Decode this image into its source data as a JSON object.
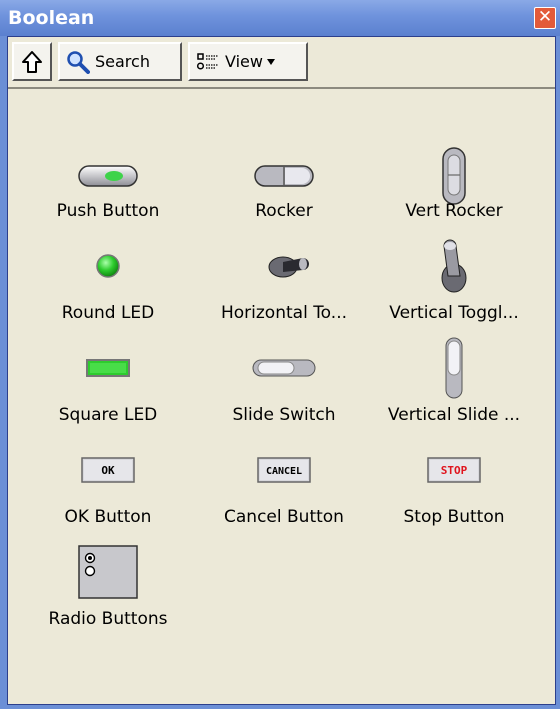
{
  "window": {
    "title": "Boolean",
    "close_glyph": "✕"
  },
  "toolbar": {
    "up_icon": "up-arrow-icon",
    "search_label": "Search",
    "view_label": "View"
  },
  "palette": [
    {
      "label": "Push Button",
      "icon": "push-button-icon"
    },
    {
      "label": "Rocker",
      "icon": "rocker-icon"
    },
    {
      "label": "Vert Rocker",
      "icon": "vert-rocker-icon"
    },
    {
      "label": "Round LED",
      "icon": "round-led-icon"
    },
    {
      "label": "Horizontal To...",
      "icon": "horizontal-toggle-icon"
    },
    {
      "label": "Vertical Toggl...",
      "icon": "vertical-toggle-icon"
    },
    {
      "label": "Square LED",
      "icon": "square-led-icon"
    },
    {
      "label": "Slide Switch",
      "icon": "slide-switch-icon"
    },
    {
      "label": "Vertical Slide ...",
      "icon": "vertical-slide-icon"
    },
    {
      "label": "OK Button",
      "icon": "ok-button-icon",
      "icon_text": "OK"
    },
    {
      "label": "Cancel Button",
      "icon": "cancel-button-icon",
      "icon_text": "CANCEL"
    },
    {
      "label": "Stop Button",
      "icon": "stop-button-icon",
      "icon_text": "STOP"
    },
    {
      "label": "Radio Buttons",
      "icon": "radio-buttons-icon"
    }
  ],
  "colors": {
    "title_bar": "#6e92dc",
    "panel": "#ece9d8",
    "led_green": "#2ecc2e",
    "stop_red": "#e0141e"
  }
}
